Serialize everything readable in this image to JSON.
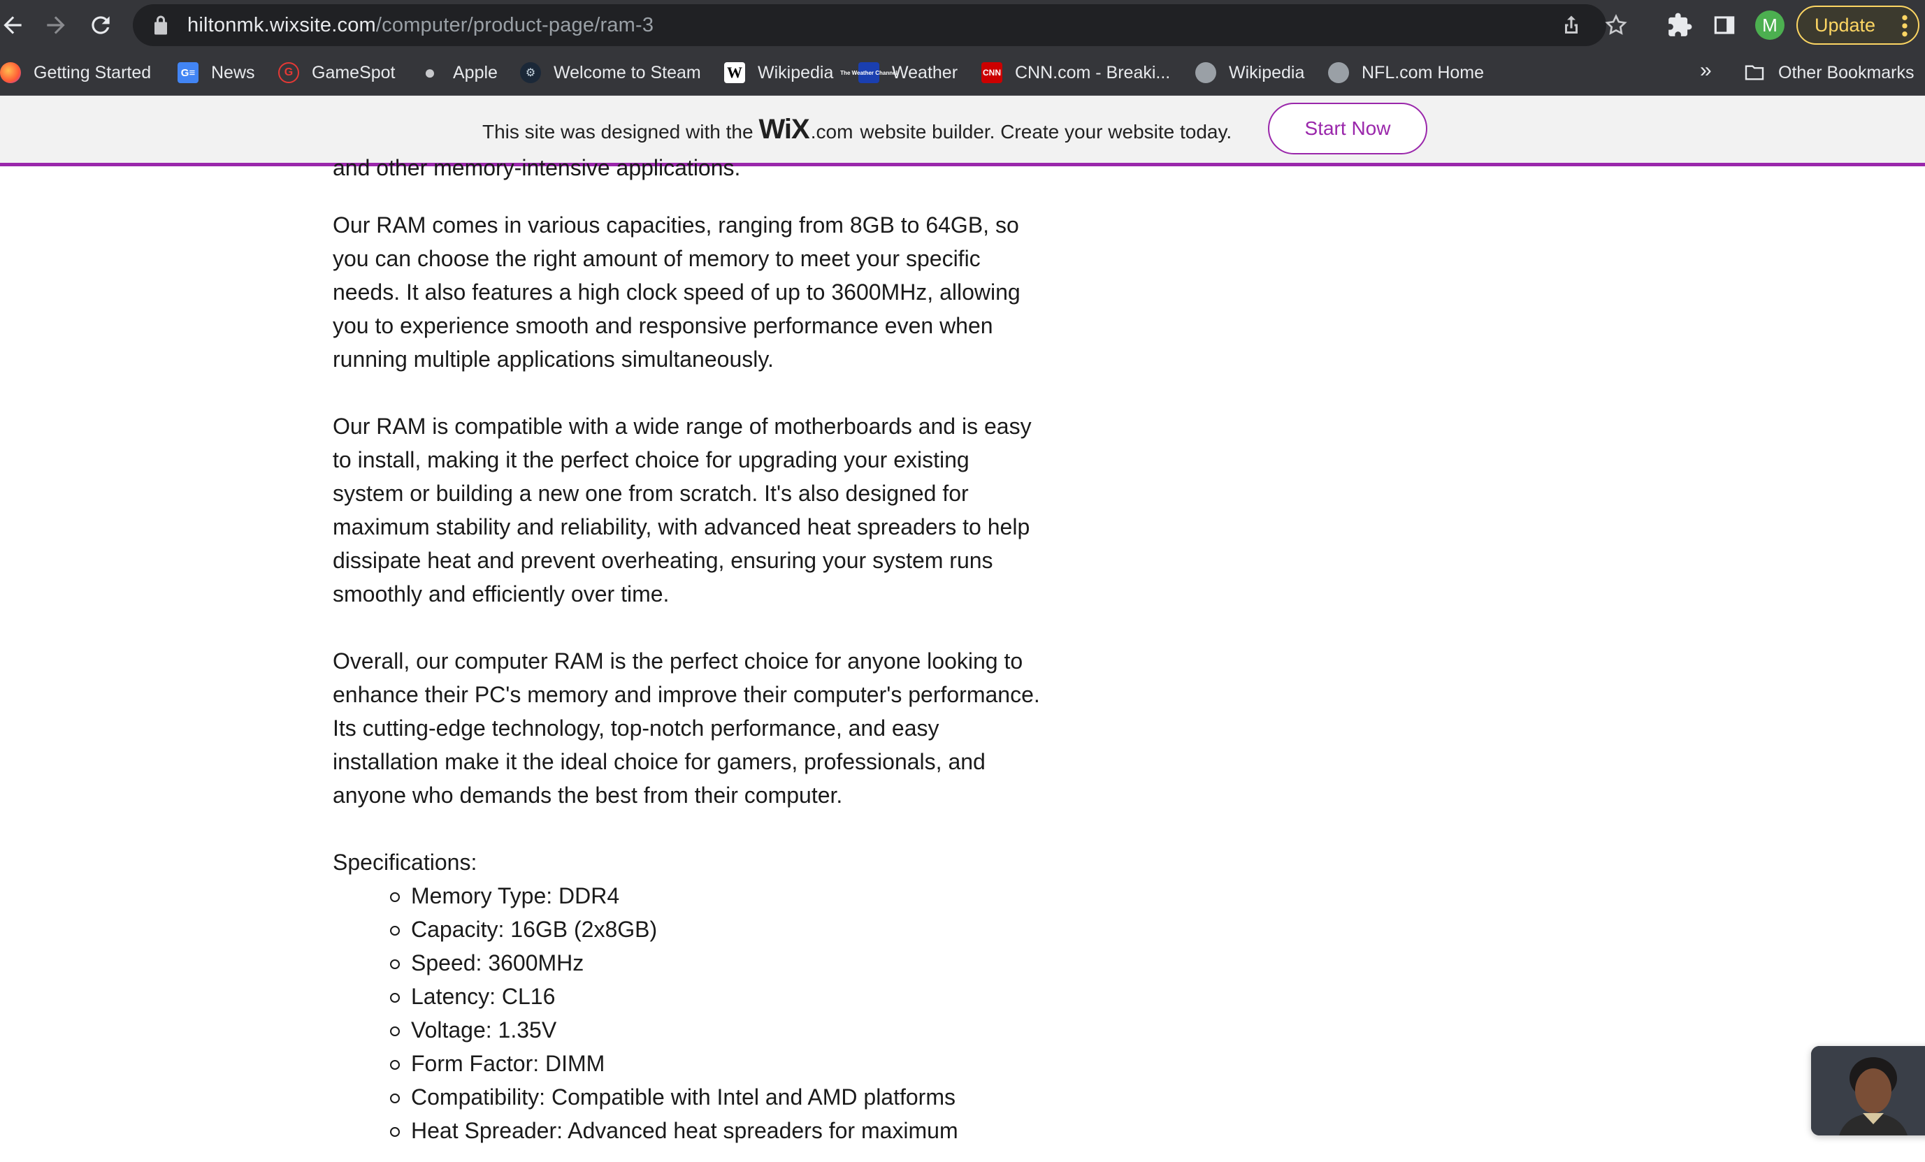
{
  "browser": {
    "url_host": "hiltonmk.wixsite.com",
    "url_path": "/computer/product-page/ram-3",
    "profile_initial": "M",
    "update_label": "Update"
  },
  "bookmarks": [
    {
      "label": "Getting Started",
      "icon": "firefox-icon"
    },
    {
      "label": "News",
      "icon": "google-news-icon"
    },
    {
      "label": "GameSpot",
      "icon": "gamespot-icon"
    },
    {
      "label": "Apple",
      "icon": "apple-icon"
    },
    {
      "label": "Welcome to Steam",
      "icon": "steam-icon"
    },
    {
      "label": "Wikipedia",
      "icon": "wikipedia-icon"
    },
    {
      "label": "Weather",
      "icon": "weather-channel-icon"
    },
    {
      "label": "CNN.com - Breaki...",
      "icon": "cnn-icon"
    },
    {
      "label": "Wikipedia",
      "icon": "globe-icon"
    },
    {
      "label": "NFL.com Home",
      "icon": "globe-icon"
    }
  ],
  "bookmarks_more": "»",
  "other_bookmarks": "Other Bookmarks",
  "wix_banner": {
    "text_before": "This site was designed with the",
    "logo": "WiX",
    "logo_suffix": ".com",
    "text_after": "website builder. Create your website today.",
    "button": "Start Now"
  },
  "content": {
    "partial_line": "and other memory-intensive applications.",
    "paragraphs": [
      "Our RAM comes in various capacities, ranging from 8GB to 64GB, so you can choose the right amount of memory to meet your specific needs. It also features a high clock speed of up to 3600MHz, allowing you to experience smooth and responsive performance even when running multiple applications simultaneously.",
      "Our RAM is compatible with a wide range of motherboards and is easy to install, making it the perfect choice for upgrading your existing system or building a new one from scratch. It's also designed for maximum stability and reliability, with advanced heat spreaders to help dissipate heat and prevent overheating, ensuring your system runs smoothly and efficiently over time.",
      "Overall, our computer RAM is the perfect choice for anyone looking to enhance their PC's memory and improve their computer's performance. Its cutting-edge technology, top-notch performance, and easy installation make it the ideal choice for gamers, professionals, and anyone who demands the best from their computer."
    ],
    "specs_heading": "Specifications:",
    "specs": [
      "Memory Type: DDR4",
      "Capacity: 16GB (2x8GB)",
      "Speed: 3600MHz",
      "Latency: CL16",
      "Voltage: 1.35V",
      "Form Factor: DIMM",
      "Compatibility: Compatible with Intel and AMD platforms",
      "Heat Spreader: Advanced heat spreaders for maximum"
    ]
  }
}
